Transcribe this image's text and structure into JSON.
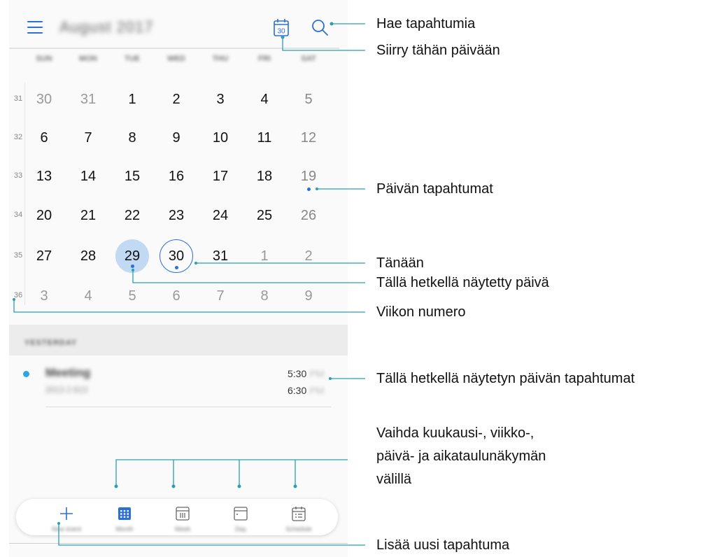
{
  "header": {
    "menu_icon": "hamburger-icon",
    "month_title": "August 2017",
    "today_icon_text": "30",
    "search_icon": "search-icon"
  },
  "weekdays": [
    "SUN",
    "MON",
    "TUE",
    "WED",
    "THU",
    "FRI",
    "SAT"
  ],
  "weeks": [
    {
      "num": "31",
      "days": [
        "30",
        "31",
        "1",
        "2",
        "3",
        "4",
        "5"
      ]
    },
    {
      "num": "32",
      "days": [
        "6",
        "7",
        "8",
        "9",
        "10",
        "11",
        "12"
      ]
    },
    {
      "num": "33",
      "days": [
        "13",
        "14",
        "15",
        "16",
        "17",
        "18",
        "19"
      ]
    },
    {
      "num": "34",
      "days": [
        "20",
        "21",
        "22",
        "23",
        "24",
        "25",
        "26"
      ]
    },
    {
      "num": "35",
      "days": [
        "27",
        "28",
        "29",
        "30",
        "31",
        "1",
        "2"
      ]
    },
    {
      "num": "36",
      "days": [
        "3",
        "4",
        "5",
        "6",
        "7",
        "8",
        "9"
      ]
    }
  ],
  "events_section": {
    "header": "YESTERDAY",
    "event": {
      "title": "Meeting",
      "subtitle": "2013 2 613",
      "time_start": "5:30",
      "time_end": "6:30",
      "ampm": "PM"
    }
  },
  "bottom_nav": [
    {
      "label": "New event",
      "icon": "plus-icon"
    },
    {
      "label": "Month",
      "icon": "month-view-icon"
    },
    {
      "label": "Week",
      "icon": "week-view-icon"
    },
    {
      "label": "Day",
      "icon": "day-view-icon"
    },
    {
      "label": "Schedule",
      "icon": "schedule-view-icon"
    }
  ],
  "callouts": {
    "search": "Hae tapahtumia",
    "today_button": "Siirry tähän päivään",
    "day_events": "Päivän tapahtumat",
    "today": "Tänään",
    "selected_day": "Tällä hetkellä näytetty päivä",
    "week_number": "Viikon numero",
    "selected_day_events": "Tällä hetkellä näytetyn päivän tapahtumat",
    "switch_views_1": "Vaihda kuukausi-, viikko-,",
    "switch_views_2": "päivä- ja aikataulunäkymän",
    "switch_views_3": "välillä",
    "add_event": "Lisää uusi tapahtuma"
  },
  "colors": {
    "accent": "#2c6fd6",
    "selected_bg": "#c2d9f3",
    "event_dot": "#2aa5e8",
    "callout_line": "#2a9fb3"
  }
}
